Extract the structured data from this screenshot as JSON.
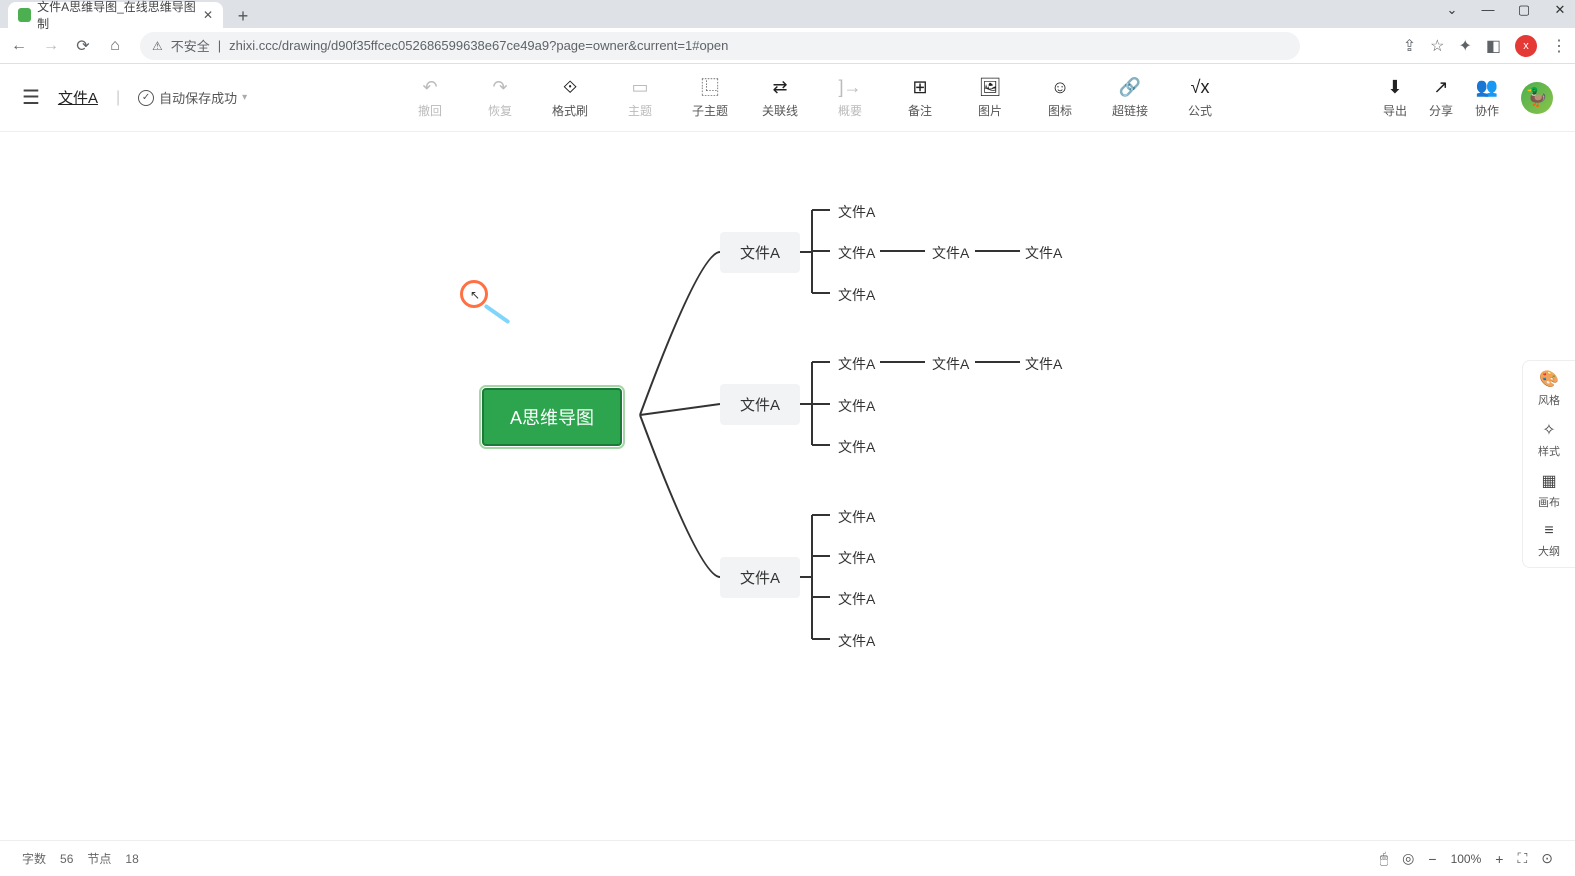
{
  "browser": {
    "tab_title": "文件A思维导图_在线思维导图制",
    "url": "zhixi.ccc/drawing/d90f35ffcec052686599638e67ce49a9?page=owner&current=1#open",
    "insecure": "不安全",
    "avatar_initial": "x"
  },
  "header": {
    "filename": "文件A",
    "save_status": "自动保存成功",
    "toolbar": {
      "undo": "撤回",
      "redo": "恢复",
      "format": "格式刷",
      "topic": "主题",
      "subtopic": "子主题",
      "relation": "关联线",
      "summary": "概要",
      "note": "备注",
      "image": "图片",
      "icon": "图标",
      "link": "超链接",
      "formula": "公式"
    },
    "right": {
      "export": "导出",
      "share": "分享",
      "collab": "协作"
    }
  },
  "mindmap": {
    "root": "A思维导图",
    "branches": [
      {
        "label": "文件A",
        "children": [
          "文件A",
          "文件A",
          "文件A"
        ],
        "extra": [
          [
            "文件A",
            "文件A"
          ]
        ]
      },
      {
        "label": "文件A",
        "children": [
          "文件A",
          "文件A",
          "文件A"
        ],
        "extra": [
          [
            "文件A",
            "文件A"
          ]
        ]
      },
      {
        "label": "文件A",
        "children": [
          "文件A",
          "文件A",
          "文件A",
          "文件A"
        ]
      }
    ]
  },
  "sidebar": {
    "style_theme": "风格",
    "style": "样式",
    "canvas": "画布",
    "outline": "大纲"
  },
  "statusbar": {
    "words_label": "字数",
    "words": "56",
    "nodes_label": "节点",
    "nodes": "18",
    "zoom": "100%"
  }
}
